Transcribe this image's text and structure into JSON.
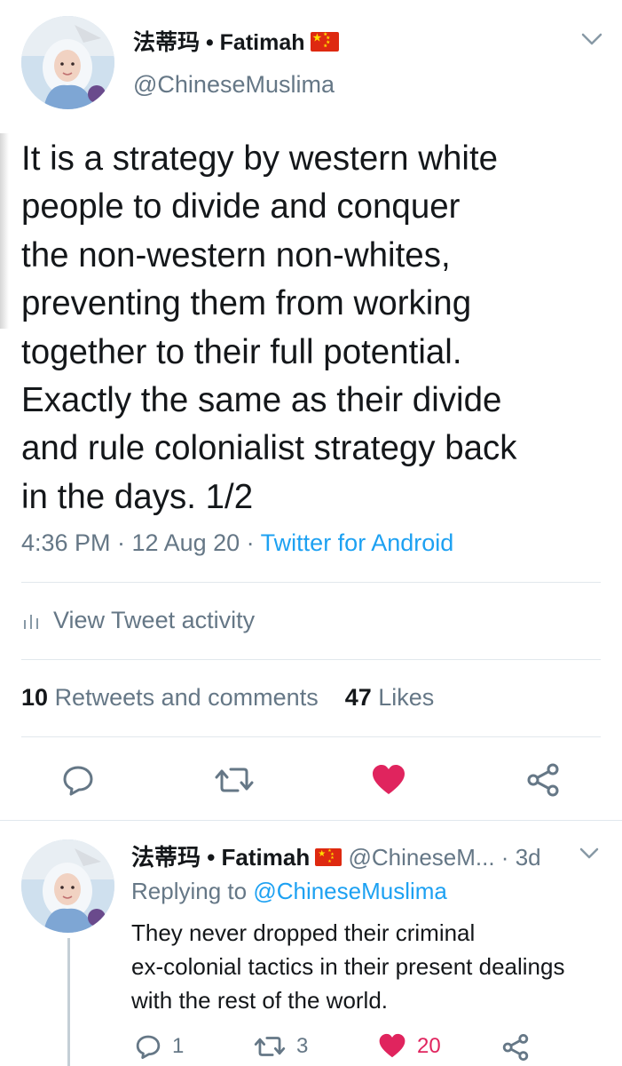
{
  "tweet": {
    "author_name": "法蒂玛 • Fatimah",
    "author_handle": "@ChineseMuslima",
    "text_lines": [
      "It is a strategy by western white",
      "people to divide and conquer",
      "the non-western non-whites,",
      "preventing them from working",
      "together to their full potential.",
      "Exactly the same as their divide",
      "and rule colonialist strategy back",
      "in the days. 1/2"
    ],
    "timestamp": "4:36 PM · 12 Aug 20 · ",
    "source": "Twitter for Android",
    "activity_label": "View Tweet activity",
    "retweets_count": "10",
    "retweets_label": "Retweets and comments",
    "likes_count": "47",
    "likes_label": "Likes"
  },
  "actions": {
    "reply_icon": "reply-bubble-icon",
    "retweet_icon": "retweet-arrows-icon",
    "like_icon": "heart-filled-icon",
    "share_icon": "share-nodes-icon"
  },
  "reply": {
    "author_name": "法蒂玛 • Fatimah",
    "handle_time": "@ChineseM... · 3d",
    "replying_prefix": "Replying to ",
    "replying_to": "@ChineseMuslima",
    "text_lines": [
      "They never dropped their criminal",
      "ex-colonial tactics in their present dealings",
      "with the rest of the world."
    ],
    "reply_count": "1",
    "retweet_count": "3",
    "like_count": "20"
  },
  "colors": {
    "primary_text": "#14171a",
    "secondary_text": "#657786",
    "link": "#1da1f2",
    "like": "#e0245e",
    "divider": "#e1e8ed",
    "flag_red": "#de2910",
    "flag_star": "#ffde00"
  }
}
